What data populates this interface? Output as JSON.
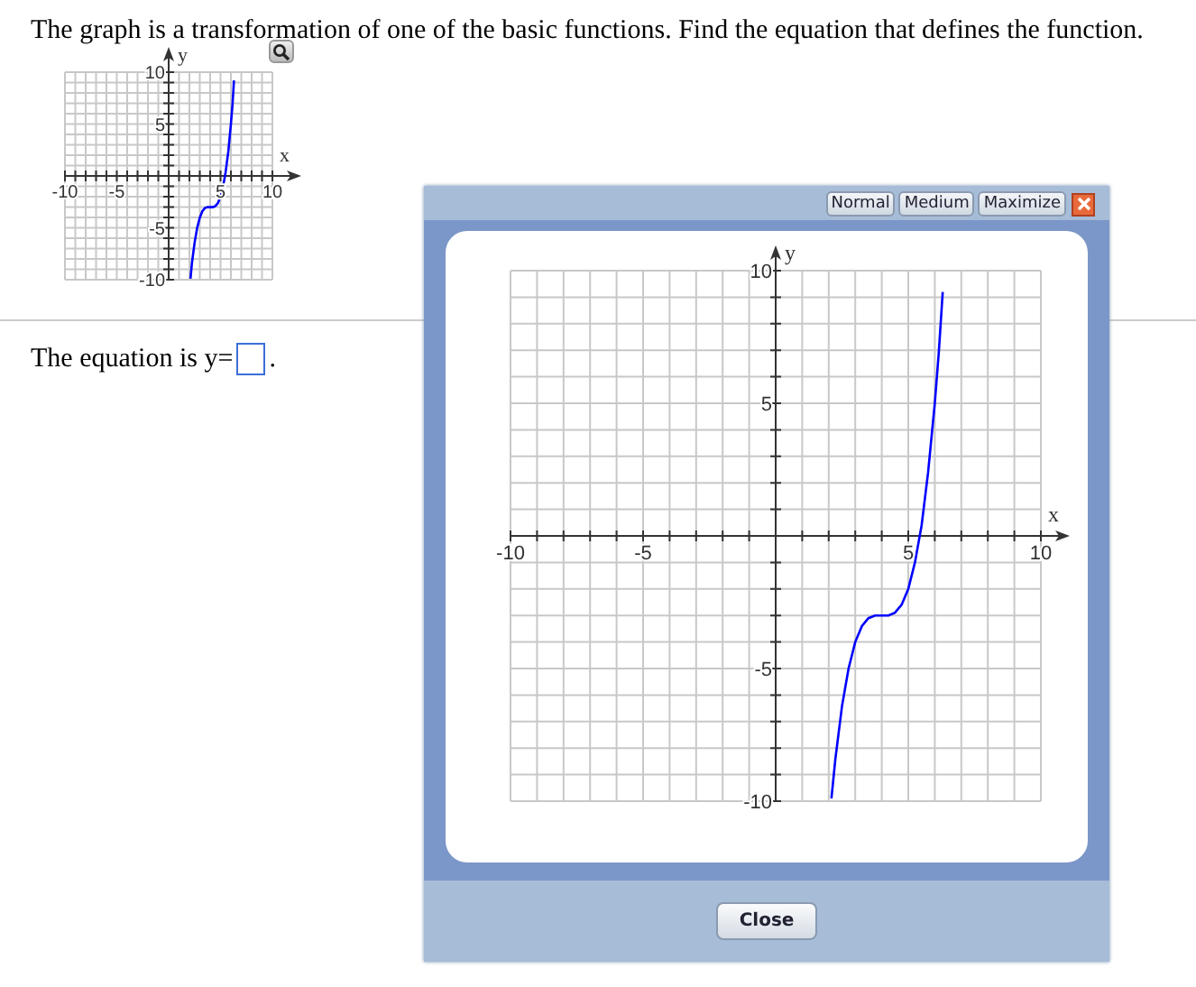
{
  "question": "The graph is a transformation of one of the basic functions. Find the equation that defines the function.",
  "thumbnail": {
    "chart_data": {
      "type": "line",
      "xlabel": "x",
      "ylabel": "y",
      "x": [
        2.1,
        2.25,
        2.5,
        2.75,
        3,
        3.25,
        3.5,
        3.75,
        4,
        4.25,
        4.5,
        4.75,
        5,
        5.25,
        5.5,
        5.75,
        6,
        6.15,
        6.3
      ],
      "series": [
        {
          "color": "#0000ff",
          "values": [
            -9.9,
            -8.4,
            -6.4,
            -5,
            -4,
            -3.4,
            -3.1,
            -3,
            -3,
            -3,
            -2.9,
            -2.6,
            -2,
            -1,
            0.4,
            2.4,
            5,
            6.9,
            9.2
          ]
        }
      ],
      "xlim": [
        -10,
        10
      ],
      "ylim": [
        -10,
        10
      ],
      "xticks": [
        -10,
        -5,
        5,
        10
      ],
      "yticks": [
        -10,
        -5,
        5,
        10
      ],
      "grid": true
    }
  },
  "answer": {
    "prompt": "The equation is y=",
    "suffix": "."
  },
  "dialog": {
    "buttons": [
      {
        "label": "Normal"
      },
      {
        "label": "Medium"
      },
      {
        "label": "Maximize"
      }
    ],
    "chart_data": {
      "type": "line",
      "xlabel": "x",
      "ylabel": "y",
      "x": [
        2.1,
        2.25,
        2.5,
        2.75,
        3,
        3.25,
        3.5,
        3.75,
        4,
        4.25,
        4.5,
        4.75,
        5,
        5.25,
        5.5,
        5.75,
        6,
        6.15,
        6.3
      ],
      "series": [
        {
          "color": "#0000ff",
          "values": [
            -9.9,
            -8.4,
            -6.4,
            -5,
            -4,
            -3.4,
            -3.1,
            -3,
            -3,
            -3,
            -2.9,
            -2.6,
            -2,
            -1,
            0.4,
            2.4,
            5,
            6.9,
            9.2
          ]
        }
      ],
      "xlim": [
        -10,
        10
      ],
      "ylim": [
        -10,
        10
      ],
      "xticks": [
        -10,
        -5,
        5,
        10
      ],
      "yticks": [
        -10,
        -5,
        5,
        10
      ],
      "grid": true
    },
    "close_button": "Close"
  }
}
